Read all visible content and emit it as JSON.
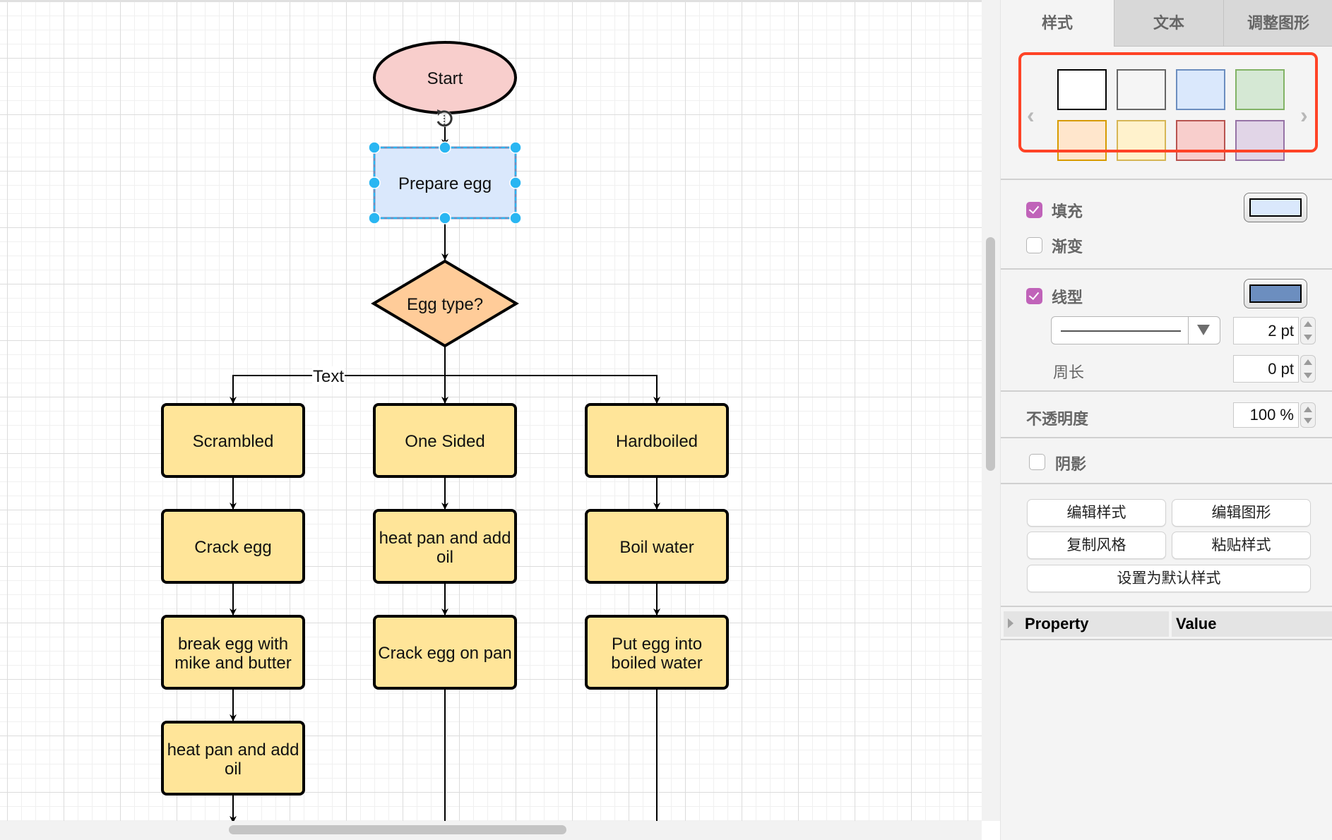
{
  "canvas": {
    "nodes": {
      "start": "Start",
      "prepare": "Prepare egg",
      "decision": "Egg type?",
      "scrambled": "Scrambled",
      "one_sided": "One Sided",
      "hardboiled": "Hardboiled",
      "crack_egg": "Crack egg",
      "heat_pan_oil_1": [
        "heat pan and add",
        "oil"
      ],
      "boil_water": "Boil water",
      "break_egg": [
        "break egg with",
        "mike and butter"
      ],
      "crack_on_pan": "Crack egg on pan",
      "put_egg": [
        "Put egg into",
        "boiled water"
      ],
      "heat_pan_oil_2": [
        "heat pan and add",
        "oil"
      ]
    },
    "edge_label": "Text",
    "colors": {
      "start_fill": "#f8cecc",
      "selected_fill": "#dae8fc",
      "selected_stroke": "#6c8ebf",
      "decision_fill": "#ffcc99",
      "process_fill": "#ffe599",
      "selection_handle": "#29b6f2"
    },
    "selected_node": "Prepare egg"
  },
  "panel": {
    "tabs": [
      {
        "label": "样式",
        "active": true
      },
      {
        "label": "文本",
        "active": false
      },
      {
        "label": "调整图形",
        "active": false
      }
    ],
    "palette": {
      "highlight_color": "#ff4326",
      "prev_icon": "chevron-left-icon",
      "next_icon": "chevron-right-icon",
      "swatches": [
        {
          "fill": "#ffffff",
          "stroke": "#000000"
        },
        {
          "fill": "#f5f5f5",
          "stroke": "#666666"
        },
        {
          "fill": "#dae8fc",
          "stroke": "#6c8ebf"
        },
        {
          "fill": "#d5e8d4",
          "stroke": "#82b366"
        },
        {
          "fill": "#ffe6cc",
          "stroke": "#d79b00"
        },
        {
          "fill": "#fff2cc",
          "stroke": "#d6b656"
        },
        {
          "fill": "#f8cecc",
          "stroke": "#b85450"
        },
        {
          "fill": "#e1d5e7",
          "stroke": "#9673a6"
        }
      ]
    },
    "fill": {
      "label": "填充",
      "checked": true,
      "color": "#dae8fc"
    },
    "gradient": {
      "label": "渐变",
      "checked": false
    },
    "line": {
      "label": "线型",
      "checked": true,
      "color": "#6c8ebf",
      "pattern": "solid",
      "width": "2 pt"
    },
    "perimeter": {
      "label": "周长",
      "value": "0 pt"
    },
    "opacity": {
      "label": "不透明度",
      "value": "100 %"
    },
    "shadow": {
      "label": "阴影",
      "checked": false
    },
    "buttons": {
      "edit_style": "编辑样式",
      "edit_shape": "编辑图形",
      "copy_style": "复制风格",
      "paste_style": "粘贴样式",
      "set_default": "设置为默认样式"
    },
    "property_table": {
      "col_property": "Property",
      "col_value": "Value"
    }
  }
}
